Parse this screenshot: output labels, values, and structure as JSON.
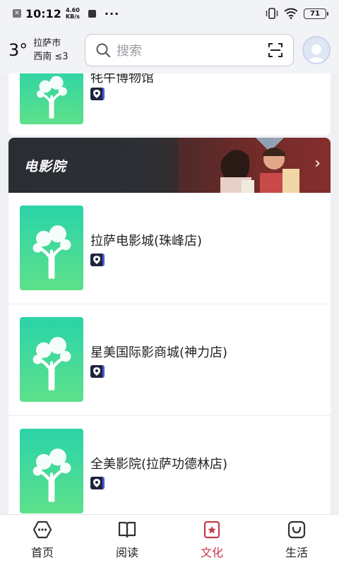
{
  "status_bar": {
    "time": "10:12",
    "speed_value": "4.60",
    "speed_unit": "KB/s",
    "dots": "···",
    "battery": "71"
  },
  "header": {
    "temperature": "3°",
    "city": "拉萨市",
    "wind": "西南 ≤3",
    "search_placeholder": "搜索"
  },
  "top_card": {
    "title": "牦牛博物馆"
  },
  "banner": {
    "title": "电影院"
  },
  "cinemas": [
    {
      "title": "拉萨电影城(珠峰店)"
    },
    {
      "title": "星美国际影商城(神力店)"
    },
    {
      "title": "全美影院(拉萨功德林店)"
    }
  ],
  "nav": {
    "items": [
      {
        "label": "首页",
        "icon": "home-icon"
      },
      {
        "label": "阅读",
        "icon": "book-icon"
      },
      {
        "label": "文化",
        "icon": "culture-icon"
      },
      {
        "label": "生活",
        "icon": "life-icon"
      }
    ],
    "active_color": "#c53a48"
  },
  "colors": {
    "thumb_gradient_top": "#2ad3a8",
    "thumb_gradient_bottom": "#5ee08a"
  }
}
